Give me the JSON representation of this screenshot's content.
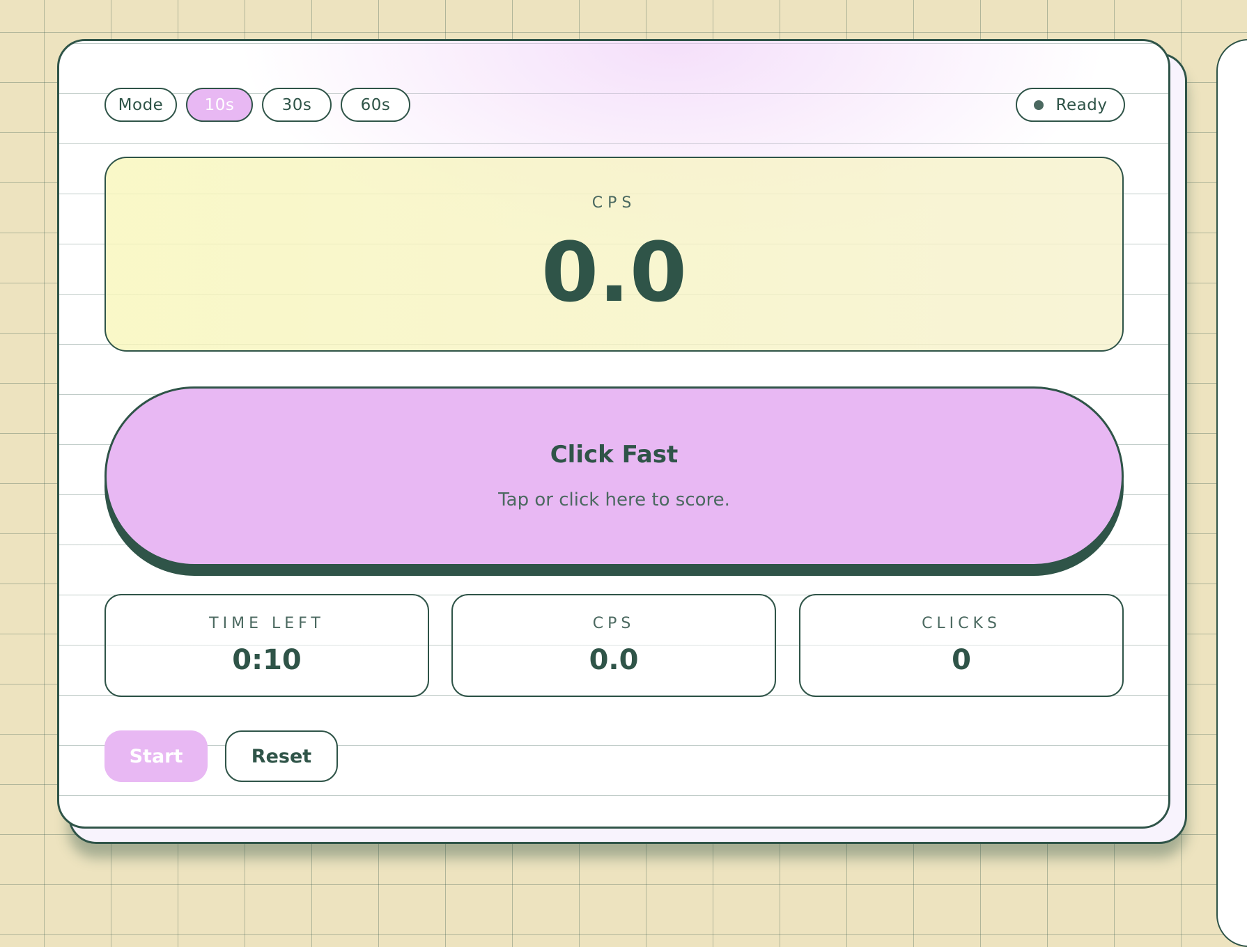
{
  "modes": {
    "label": "Mode",
    "options": [
      "10s",
      "30s",
      "60s"
    ],
    "selected": "10s"
  },
  "status": {
    "label": "Ready"
  },
  "score": {
    "label": "CPS",
    "value": "0.0"
  },
  "click_area": {
    "title": "Click Fast",
    "subtitle": "Tap or click here to score."
  },
  "stats": [
    {
      "label": "TIME LEFT",
      "value": "0:10"
    },
    {
      "label": "CPS",
      "value": "0.0"
    },
    {
      "label": "CLICKS",
      "value": "0"
    }
  ],
  "controls": {
    "start_label": "Start",
    "reset_label": "Reset"
  },
  "colors": {
    "accent": "#e8b8f3",
    "ink": "#2f5448",
    "panel": "#f8f6ba",
    "background": "#ede3bf"
  }
}
